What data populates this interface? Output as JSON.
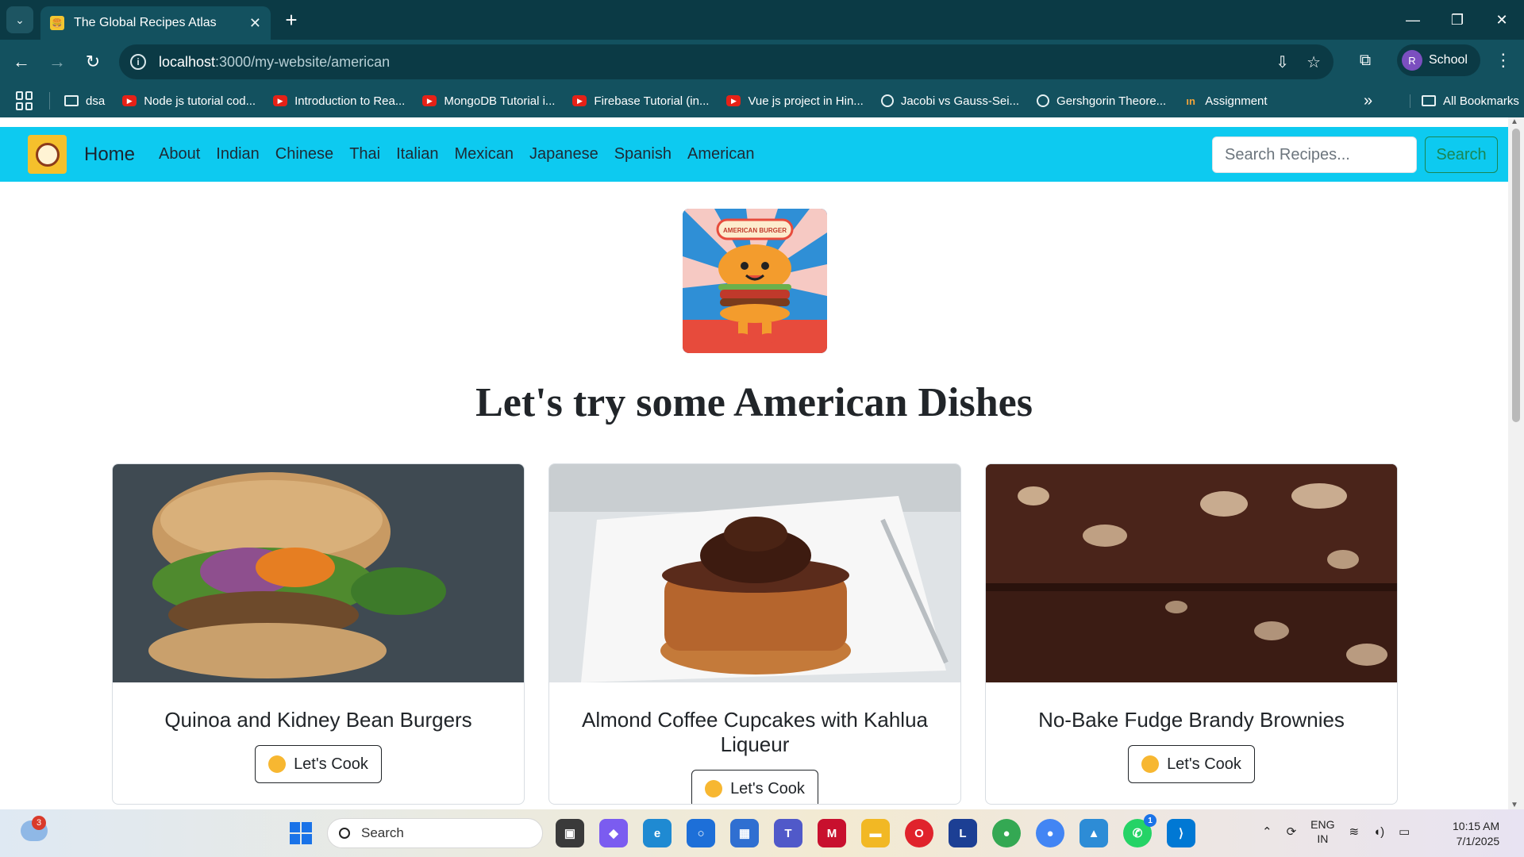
{
  "browser": {
    "tab_title": "The Global Recipes Atlas",
    "url_host": "localhost",
    "url_path": ":3000/my-website/american",
    "profile_initial": "R",
    "profile_name": "School",
    "bookmarks": [
      {
        "label": "dsa",
        "icon": "folder-icon"
      },
      {
        "label": "Node js tutorial cod...",
        "icon": "youtube-icon"
      },
      {
        "label": "Introduction to Rea...",
        "icon": "youtube-icon"
      },
      {
        "label": "MongoDB Tutorial i...",
        "icon": "youtube-icon"
      },
      {
        "label": "Firebase Tutorial (in...",
        "icon": "youtube-icon"
      },
      {
        "label": "Vue js project in Hin...",
        "icon": "youtube-icon"
      },
      {
        "label": "Jacobi vs Gauss-Sei...",
        "icon": "openai-icon"
      },
      {
        "label": "Gershgorin Theore...",
        "icon": "openai-icon"
      },
      {
        "label": "Assignment",
        "icon": "in-icon"
      }
    ],
    "all_bookmarks": "All Bookmarks"
  },
  "site": {
    "brand": "Home",
    "nav": [
      "About",
      "Indian",
      "Chinese",
      "Thai",
      "Italian",
      "Mexican",
      "Japanese",
      "Spanish",
      "American"
    ],
    "search_placeholder": "Search Recipes...",
    "search_button": "Search",
    "hero_badge": "AMERICAN BURGER",
    "heading": "Let's try some American Dishes",
    "cards": [
      {
        "title": "Quinoa and Kidney Bean Burgers",
        "button": "Let's Cook"
      },
      {
        "title": "Almond Coffee Cupcakes with Kahlua Liqueur",
        "button": "Let's Cook"
      },
      {
        "title": "No-Bake Fudge Brandy Brownies",
        "button": "Let's Cook"
      }
    ]
  },
  "taskbar": {
    "weather_badge": "3",
    "search_label": "Search",
    "whatsapp_badge": "1",
    "lang_line1": "ENG",
    "lang_line2": "IN",
    "time": "10:15 AM",
    "date": "7/1/2025"
  },
  "colors": {
    "nav_bg": "#0dcaf0",
    "search_button": "#198754",
    "chrome_dark": "#0b3a45",
    "chrome_mid": "#13515f"
  }
}
